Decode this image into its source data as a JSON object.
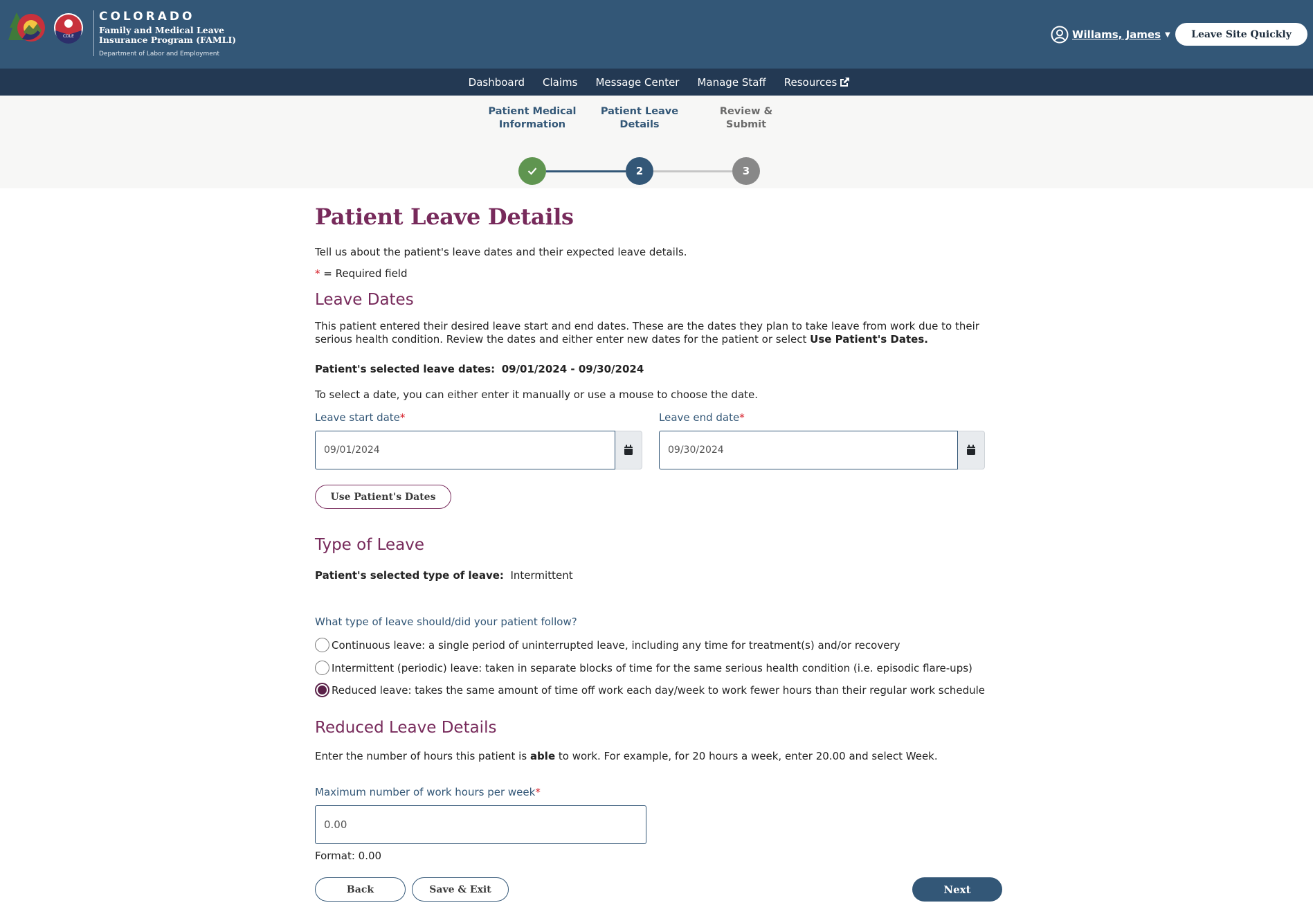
{
  "header": {
    "brand_title": "COLORADO",
    "brand_subtitle": "Family and Medical Leave Insurance Program (FAMLI)",
    "brand_department": "Department of Labor and Employment",
    "logo_badge": "CDLE",
    "user_name": "Willams, James",
    "leave_site_button": "Leave Site Quickly"
  },
  "nav": {
    "items": [
      {
        "label": "Dashboard"
      },
      {
        "label": "Claims"
      },
      {
        "label": "Message Center"
      },
      {
        "label": "Manage Staff"
      },
      {
        "label": "Resources",
        "icon": "external-link-icon"
      }
    ]
  },
  "stepper": {
    "steps": [
      {
        "label": "Patient Medical Information",
        "number": "1",
        "status": "complete",
        "color": "#5f9550"
      },
      {
        "label": "Patient Leave Details",
        "number": "2",
        "status": "current",
        "color": "#335777"
      },
      {
        "label": "Review & Submit",
        "number": "3",
        "status": "pending",
        "color": "#888888"
      }
    ]
  },
  "page": {
    "title": "Patient Leave Details",
    "intro": "Tell us about the patient's leave dates and their expected leave details.",
    "required_marker": "*",
    "required_note": " = Required field"
  },
  "leave_dates": {
    "heading": "Leave Dates",
    "description": "This patient entered their desired leave start and end dates. These are the dates they plan to take leave from work due to their serious health condition. Review the dates and either enter new dates for the patient or select ",
    "description_bold": "Use Patient's Dates.",
    "selected_label": "Patient's selected leave dates:",
    "selected_value": "09/01/2024 - 09/30/2024",
    "instruction": "To select a date, you can either enter it manually or use a mouse to choose the date.",
    "start_label": "Leave start date",
    "start_value": "09/01/2024",
    "end_label": "Leave end date",
    "end_value": "09/30/2024",
    "use_dates_button": "Use Patient's Dates"
  },
  "type_of_leave": {
    "heading": "Type of Leave",
    "selected_label": "Patient's selected type of leave:",
    "selected_value": "Intermittent",
    "question": "What type of leave should/did your patient follow?",
    "options": [
      {
        "label": "Continuous leave: a single period of uninterrupted leave, including any time for treatment(s) and/or recovery",
        "checked": false
      },
      {
        "label": "Intermittent (periodic) leave: taken in separate blocks of time for the same serious health condition (i.e. episodic flare-ups)",
        "checked": false
      },
      {
        "label": "Reduced leave: takes the same amount of time off work each day/week to work fewer hours than their regular work schedule",
        "checked": true
      }
    ]
  },
  "reduced_leave": {
    "heading": "Reduced Leave Details",
    "instruction_pre": "Enter the number of hours this patient is ",
    "instruction_bold": "able",
    "instruction_post": " to work. For example, for 20 hours a week, enter 20.00 and select Week.",
    "hours_label": "Maximum number of work hours per week",
    "hours_value": "0.00",
    "format_hint": "Format: 0.00"
  },
  "actions": {
    "back": "Back",
    "save_exit": "Save & Exit",
    "next": "Next"
  }
}
